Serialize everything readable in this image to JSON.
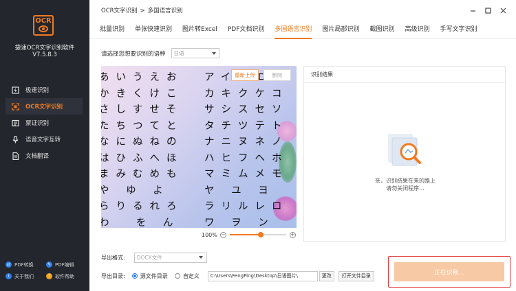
{
  "app": {
    "logo_text": "OCR",
    "name": "捷速OCR文字识别软件",
    "version": "V7.5.8.3"
  },
  "sidebar": {
    "items": [
      {
        "label": "极速识别",
        "icon": "lightning-icon",
        "active": false
      },
      {
        "label": "OCR文字识别",
        "icon": "ocr-scan-icon",
        "active": true
      },
      {
        "label": "票证识别",
        "icon": "ticket-icon",
        "active": false
      },
      {
        "label": "语音文字互转",
        "icon": "microphone-icon",
        "active": false
      },
      {
        "label": "文档翻译",
        "icon": "document-translate-icon",
        "active": false
      }
    ],
    "bottom_links": [
      {
        "label": "PDF转换",
        "icon": "pdf-convert-icon",
        "color": "#2f80ed"
      },
      {
        "label": "PDF编辑",
        "icon": "pdf-edit-icon",
        "color": "#2f80ed"
      },
      {
        "label": "关于我们",
        "icon": "info-icon",
        "color": "#2f80ed"
      },
      {
        "label": "软件帮助",
        "icon": "help-icon",
        "color": "#f0a21f"
      }
    ]
  },
  "header": {
    "breadcrumb_root": "OCR文字识别",
    "breadcrumb_sep": ">",
    "breadcrumb_current": "多国语言识别",
    "window_controls": [
      "minimize",
      "maximize",
      "close"
    ]
  },
  "tabs": [
    {
      "label": "批量识别",
      "active": false
    },
    {
      "label": "单张快速识别",
      "active": false
    },
    {
      "label": "图片转Excel",
      "active": false
    },
    {
      "label": "PDF文档识别",
      "active": false
    },
    {
      "label": "多国语言识别",
      "active": true
    },
    {
      "label": "图片局部识别",
      "active": false
    },
    {
      "label": "截图识别",
      "active": false
    },
    {
      "label": "高级识别",
      "active": false
    },
    {
      "label": "手写文字识别",
      "active": false
    }
  ],
  "language": {
    "label": "请选择您想要识别的语种",
    "selected": "日语"
  },
  "preview": {
    "reupload_label": "重新上传",
    "delete_label": "删除",
    "hiragana_lines": [
      "あいうえお",
      "かきくけこ",
      "さしすせそ",
      "たちつてと",
      "なにぬねの",
      "はひふへほ",
      "まみむめも",
      "や ゆ よ",
      "らりるれろ",
      "わ  を ん"
    ],
    "katakana_lines": [
      "アイウエオ",
      "カキクケコ",
      "サシスセソ",
      "タチツテト",
      "ナニヌネノ",
      "ハヒフヘホ",
      "マミムメモ",
      "ヤ ユ ヨ",
      "ラリルレロ",
      "ワ ヲ ン"
    ],
    "zoom_label": "100%",
    "zoom_level": 0.55
  },
  "result": {
    "title": "识别结果",
    "message_line1": "亲，识别结果在来的路上",
    "message_line2": "请勿关闭程序..."
  },
  "export": {
    "format_label": "导出格式:",
    "format_value": "DOCX文件",
    "dir_label": "导出目录:",
    "option_source": "源文件目录",
    "option_custom": "自定义",
    "selected_option": "source",
    "path": "C:\\Users\\FengPing\\Desktop\\日语图片\\",
    "change_label": "更改",
    "open_dir_label": "打开文件目录"
  },
  "action": {
    "recognize_label": "正在识别..."
  },
  "colors": {
    "accent": "#f07a1f",
    "sidebar_bg": "#23262d",
    "highlight_border": "#e4393c"
  }
}
